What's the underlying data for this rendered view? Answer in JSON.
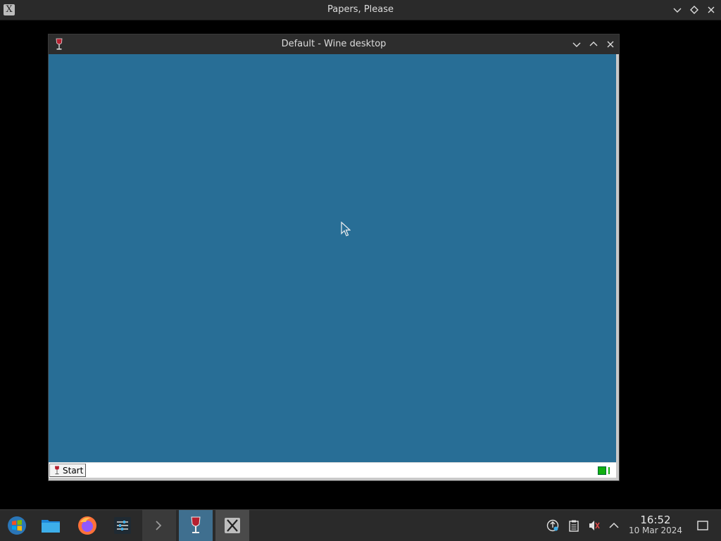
{
  "outer_window": {
    "title": "Papers, Please",
    "buttons": [
      "minimize",
      "float",
      "close"
    ]
  },
  "wine_window": {
    "title": "Default - Wine desktop",
    "desktop_color": "#286e96",
    "taskbar": {
      "start_label": "Start"
    }
  },
  "panel": {
    "tasks": [
      {
        "name": "start-menu",
        "icon": "windows-logo-icon"
      },
      {
        "name": "file-manager",
        "icon": "folder-icon"
      },
      {
        "name": "firefox",
        "icon": "firefox-icon"
      },
      {
        "name": "settings",
        "icon": "sliders-icon"
      },
      {
        "name": "terminal",
        "icon": "terminal-icon"
      },
      {
        "name": "wine",
        "icon": "wine-glass-icon"
      },
      {
        "name": "x-window",
        "icon": "x-logo-icon"
      }
    ],
    "tray": [
      "network-icon",
      "clipboard-icon",
      "volume-muted-icon",
      "chevron-up-icon"
    ],
    "clock": {
      "time": "16:52",
      "date": "10 Mar 2024"
    }
  },
  "colors": {
    "accent": "#3f6f8f",
    "panel_bg": "#2a2a2a",
    "desktop_bg": "#000000"
  }
}
